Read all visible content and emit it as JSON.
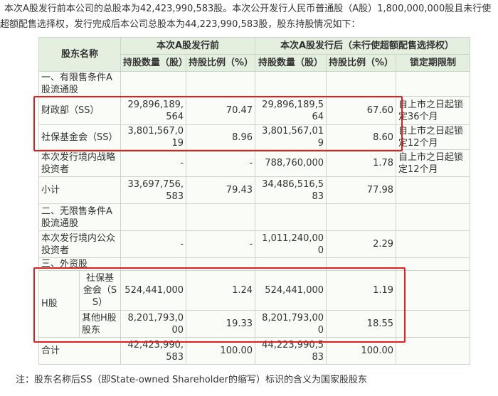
{
  "intro": {
    "line1": "本次A股发行前本公司的总股本为42,423,990,583股。本次公开发行人民币普通股（A股）1,800,000,000股且未行使",
    "line2": "超额配售选择权，发行完成后本公司总股本为44,223,990,583股，股东持股情况如下："
  },
  "table": {
    "header": {
      "name": "股东名称",
      "before": "本次A股发行前",
      "after": "本次A股发行后（未行使超额配售选择权）",
      "qty_before": "持股数量（股）",
      "ratio_before": "持股比例（%）",
      "qty_after": "持股数量（股）",
      "ratio_after": "持股比例（%）",
      "lockup": "锁定期限制"
    },
    "rows": {
      "sec1": "一、有限售条件A股流通股",
      "mof": {
        "name": "财政部（SS）",
        "qb": "29,896,189,564",
        "rb": "70.47",
        "qa": "29,896,189,564",
        "ra": "67.60",
        "lock": "自上市之日起锁定36个月"
      },
      "ssf": {
        "name": "社保基金会（SS）",
        "qb": "3,801,567,019",
        "rb": "8.96",
        "qa": "3,801,567,019",
        "ra": "8.60",
        "lock": "自上市之日起锁定12个月"
      },
      "strat": {
        "name": "本次发行境内战略投资者",
        "qb": "-",
        "rb": "-",
        "qa": "788,760,000",
        "ra": "1.78",
        "lock": "自上市之日起锁定12个月"
      },
      "sub": {
        "name": "小计",
        "qb": "33,697,756,583",
        "rb": "79.43",
        "qa": "34,486,516,583",
        "ra": "77.98",
        "lock": ""
      },
      "sec2": "二、无限售条件A股流通股",
      "pub": {
        "name": "本次发行境内公众投资者",
        "qb": "-",
        "rb": "-",
        "qa": "1,011,240,000",
        "ra": "2.29",
        "lock": ""
      },
      "sec3": "三、外资股",
      "h_label": "H股",
      "h_ssf": {
        "name": "社保基金会（SS）",
        "qb": "524,441,000",
        "rb": "1.24",
        "qa": "524,441,000",
        "ra": "1.19",
        "lock": ""
      },
      "h_other": {
        "name": "其他H股股东",
        "qb": "8,201,793,000",
        "rb": "19.33",
        "qa": "8,201,793,000",
        "ra": "18.55",
        "lock": ""
      },
      "total": {
        "name": "合计",
        "qb": "42,423,990,583",
        "rb": "100.00",
        "qa": "44,223,990,583",
        "ra": "100.00",
        "lock": ""
      }
    }
  },
  "footnote": "注：股东名称后SS（即State-owned Shareholder的缩写）标识的含义为国家股股东",
  "colors": {
    "header_bg": "#e4efdf",
    "cell_bg": "#f9fcf7",
    "border": "#c9d6c9",
    "highlight": "#e02020"
  }
}
